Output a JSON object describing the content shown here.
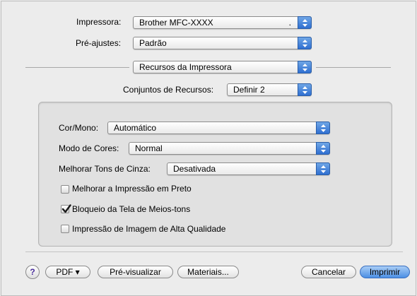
{
  "header": {
    "printer_label": "Impressora:",
    "printer_value": "Brother MFC-XXXX",
    "printer_extra": ".",
    "presets_label": "Pré-ajustes:",
    "presets_value": "Padrão"
  },
  "section": {
    "menu_value": "Recursos da Impressora",
    "feature_sets_label": "Conjuntos de Recursos:",
    "feature_sets_value": "Definir 2"
  },
  "options": {
    "color_mono_label": "Cor/Mono:",
    "color_mono_value": "Automático",
    "color_mode_label": "Modo de Cores:",
    "color_mode_value": "Normal",
    "grayscale_label": "Melhorar Tons de Cinza:",
    "grayscale_value": "Desativada",
    "checkboxes": [
      {
        "label": "Melhorar a Impressão em Preto",
        "checked": false
      },
      {
        "label": "Bloqueio da Tela de Meios-tons",
        "checked": true
      },
      {
        "label": "Impressão de Imagem de Alta Qualidade",
        "checked": false
      }
    ]
  },
  "footer": {
    "help_symbol": "?",
    "pdf_label": "PDF ▾",
    "preview_label": "Pré-visualizar",
    "supplies_label": "Materiais...",
    "cancel_label": "Cancelar",
    "print_label": "Imprimir"
  },
  "colors": {
    "accent": "#2f6fd1",
    "default_button": "#4c8fe4",
    "background": "#ececec",
    "group_background": "#e1e1e1"
  },
  "icons": [
    "popup-arrows-icon",
    "checkmark-icon",
    "help-icon"
  ]
}
